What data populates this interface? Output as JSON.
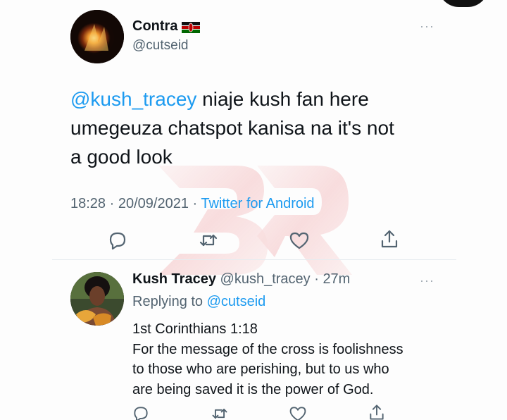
{
  "main_tweet": {
    "display_name": "Contra",
    "handle": "@cutseid",
    "mention": "@kush_tracey",
    "text_line1": " niaje kush fan here",
    "text_line2": "umegeuza chatspot kanisa na it's not",
    "text_line3": "a good look",
    "time": "18:28",
    "date": "20/09/2021",
    "source": "Twitter for Android"
  },
  "reply_tweet": {
    "display_name": "Kush Tracey",
    "handle": "@kush_tracey",
    "age": "27m",
    "replying_prefix": "Replying to",
    "replying_to": "@cutseid",
    "lines": [
      "1st Corinthians 1:18",
      "For the message of the cross is foolishness",
      "to those who are perishing, but to us who",
      "are being saved it is the power of God."
    ]
  },
  "more_symbol": "···",
  "separator": "·",
  "icons": {
    "reply": "reply-icon",
    "retweet": "retweet-icon",
    "like": "heart-icon",
    "share": "share-icon",
    "flag": "kenya-flag-icon"
  },
  "colors": {
    "link": "#1d9bf0",
    "secondary_text": "#536471",
    "primary_text": "#0f1419",
    "watermark": "#e0393e"
  }
}
